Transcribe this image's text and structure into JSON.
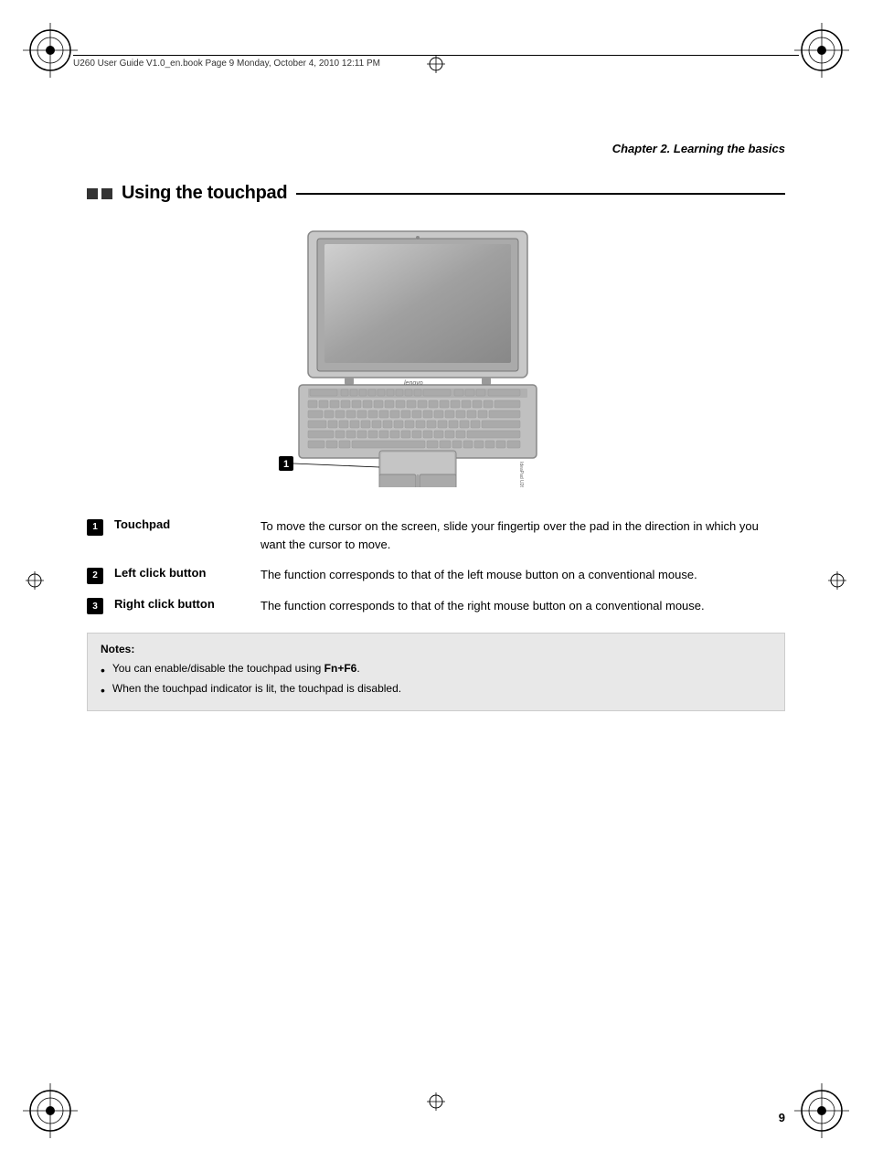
{
  "page": {
    "number": "9"
  },
  "header": {
    "file_info": "U260 User Guide V1.0_en.book  Page 9  Monday, October 4, 2010  12:11 PM"
  },
  "chapter": {
    "title": "Chapter 2. Learning the basics"
  },
  "section": {
    "title": "Using the touchpad",
    "squares": [
      "■",
      "■"
    ]
  },
  "items": [
    {
      "number": "1",
      "label": "Touchpad",
      "description": "To move the cursor on the screen, slide your fingertip over the pad in the direction in which you want the cursor to move."
    },
    {
      "number": "2",
      "label": "Left click button",
      "description": "The function corresponds to that of the left mouse button on a conventional mouse."
    },
    {
      "number": "3",
      "label": "Right click button",
      "description": "The function corresponds to that of the right mouse button on a conventional mouse."
    }
  ],
  "notes": {
    "title": "Notes:",
    "items": [
      {
        "text_before": "You can enable/disable the touchpad using ",
        "text_bold": "Fn+F6",
        "text_after": "."
      },
      {
        "text_before": "When the touchpad indicator is lit, the touchpad is disabled.",
        "text_bold": "",
        "text_after": ""
      }
    ]
  }
}
